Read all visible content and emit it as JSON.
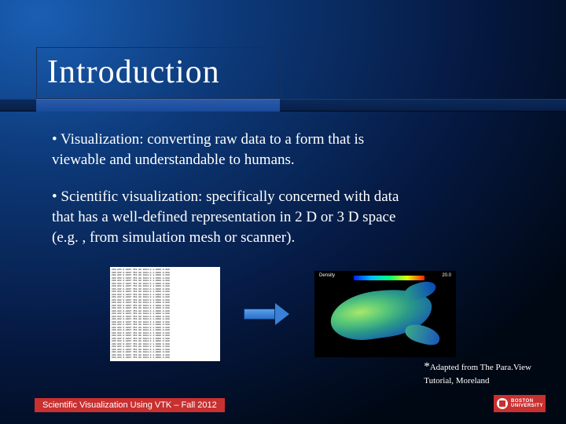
{
  "title": "Introduction",
  "bullets": [
    "• Visualization: converting raw data to a form that is viewable and understandable to humans.",
    "• Scientific visualization: specifically concerned with data that has a well-defined representation in 2 D or 3 D space (e.g. , from simulation mesh or scanner)."
  ],
  "viz": {
    "label_left": "Density",
    "label_right": "20.0"
  },
  "citation": {
    "star": "*",
    "line1": "Adapted from The Para.View",
    "line2": "Tutorial, Moreland"
  },
  "footer": "Scientific Visualization Using VTK – Fall 2012",
  "logo": {
    "l1": "BOSTON",
    "l2": "UNIVERSITY"
  },
  "raw_data_sample": "209.863 0.0007 351.00 1984.0 1.0000 0.000\n209.863 0.0007 351.00 1984.0 1.0000 0.000\n209.863 0.0007 351.00 1984.0 1.0000 0.000\n209.863 0.0007 351.00 1984.0 1.0000 0.000\n209.863 0.0007 351.00 1984.0 1.0000 0.000\n209.863 0.0007 351.00 1984.0 1.0000 0.000\n209.863 0.0007 351.00 1984.0 1.0000 0.000\n209.863 0.0007 351.00 1984.0 1.0000 0.000\n209.863 0.0007 351.00 1984.0 1.0000 0.000\n209.863 0.0007 351.00 1984.0 1.0000 0.000\n209.863 0.0007 351.00 1984.0 1.0000 0.000\n209.863 0.0007 351.00 1984.0 1.0000 0.000\n209.863 0.0007 351.00 1984.0 1.0000 0.000\n209.863 0.0007 351.00 1984.0 1.0000 0.000\n209.863 0.0007 351.00 1984.0 1.0000 0.000\n209.863 0.0007 351.00 1984.0 1.0000 0.000\n209.863 0.0007 351.00 1984.0 1.0000 0.000\n209.863 0.0007 351.00 1984.0 1.0000 0.000\n209.863 0.0007 351.00 1984.0 1.0000 0.000\n209.863 0.0007 351.00 1984.0 1.0000 0.000\n209.863 0.0007 351.00 1984.0 1.0000 0.000\n209.863 0.0007 351.00 1984.0 1.0000 0.000\n209.863 0.0007 351.00 1984.0 1.0000 0.000\n209.863 0.0007 351.00 1984.0 1.0000 0.000\n209.863 0.0007 351.00 1984.0 1.0000 0.000\n209.863 0.0007 351.00 1984.0 1.0000 0.000\n209.863 0.0007 351.00 1984.0 1.0000 0.000\n209.863 0.0007 351.00 1984.0 1.0000 0.000\n209.863 0.0007 351.00 1984.0 1.0000 0.000\n209.863 0.0007 351.00 1984.0 1.0000 0.000\n209.863 0.0007 351.00 1984.0 1.0000 0.000\n209.863 0.0007 351.00 1984.0 1.0000 0.000\n209.863 0.0007 351.00 1984.0 1.0000 0.000"
}
